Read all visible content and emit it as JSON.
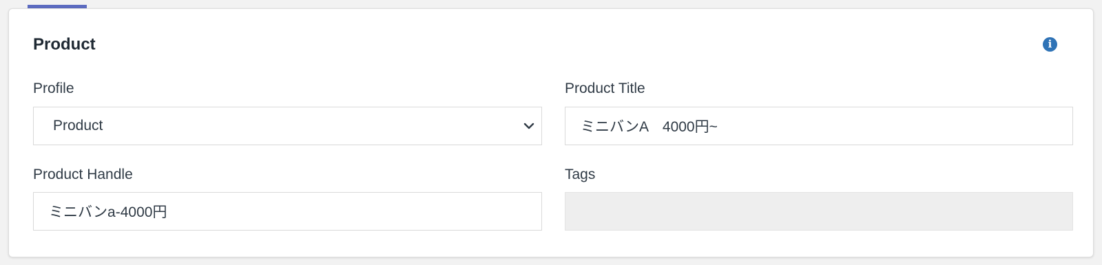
{
  "card": {
    "title": "Product",
    "info_icon": "info-circle-icon"
  },
  "fields": {
    "profile": {
      "label": "Profile",
      "value": "Product"
    },
    "product_title": {
      "label": "Product Title",
      "value": "ミニバンA　4000円~"
    },
    "product_handle": {
      "label": "Product Handle",
      "value": "ミニバンa-4000円"
    },
    "tags": {
      "label": "Tags",
      "value": ""
    }
  },
  "colors": {
    "accent_tab": "#5c6bc0",
    "info_icon": "#2f73b6",
    "disabled_field_bg": "#eeeeee"
  }
}
